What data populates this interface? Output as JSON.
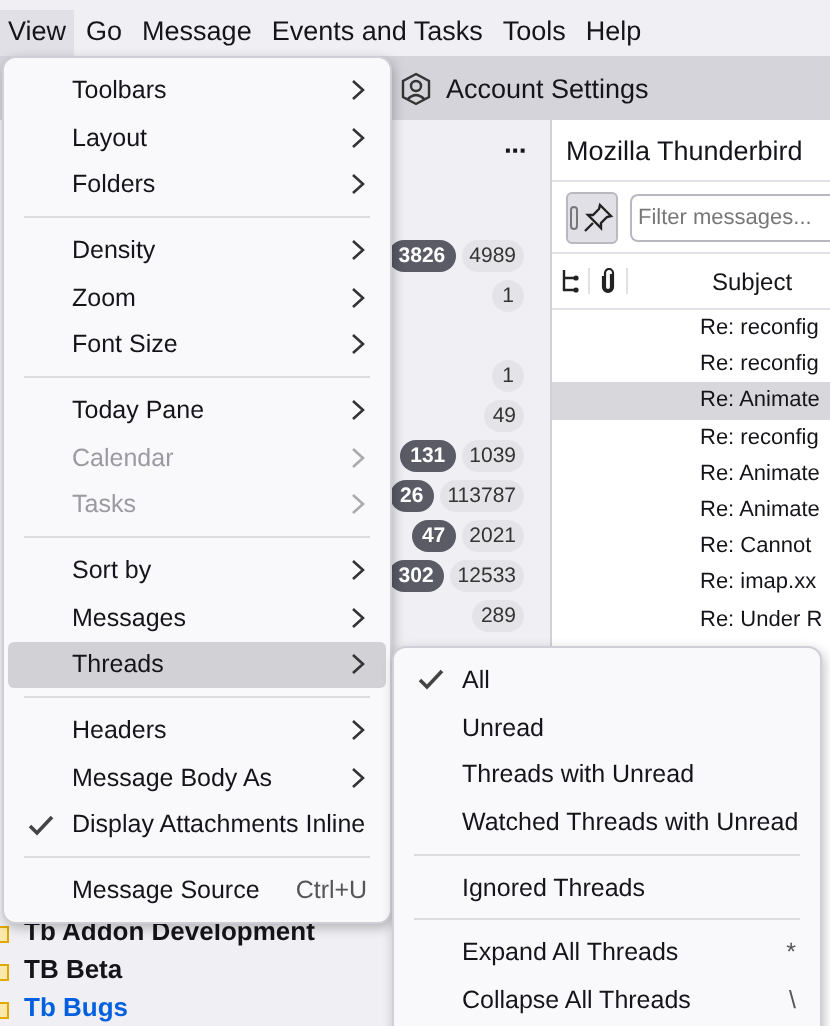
{
  "menubar": [
    {
      "label": "View",
      "selected": true
    },
    {
      "label": "Go",
      "selected": false
    },
    {
      "label": "Message",
      "selected": false
    },
    {
      "label": "Events and Tasks",
      "selected": false
    },
    {
      "label": "Tools",
      "selected": false
    },
    {
      "label": "Help",
      "selected": false
    }
  ],
  "tab": {
    "label": "Account Settings"
  },
  "folder_pane": {
    "menu_button": "···",
    "counts": [
      {
        "unread": "3826",
        "total": "4989"
      },
      {
        "total": "1"
      },
      {
        "total": "1"
      },
      {
        "total": "49"
      },
      {
        "unread": "131",
        "total": "1039"
      },
      {
        "unread": "26",
        "total": "113787"
      },
      {
        "unread": "47",
        "total": "2021"
      },
      {
        "unread": "302",
        "total": "12533"
      },
      {
        "total": "289"
      }
    ],
    "folders": [
      {
        "name": "Tb Addon Development",
        "bold": true,
        "link": false
      },
      {
        "name": "TB Beta",
        "bold": true,
        "link": false
      },
      {
        "name": "Tb Bugs",
        "bold": true,
        "link": true
      }
    ]
  },
  "message_pane": {
    "title": "Mozilla Thunderbird",
    "filter_placeholder": "Filter messages...",
    "subject_column": "Subject",
    "rows": [
      {
        "subject": "Re: reconfig",
        "selected": false
      },
      {
        "subject": "Re: reconfig",
        "selected": false
      },
      {
        "subject": "Re: Animate",
        "selected": true
      },
      {
        "subject": "Re: reconfig",
        "selected": false
      },
      {
        "subject": "Re: Animate",
        "selected": false
      },
      {
        "subject": "Re: Animate",
        "selected": false
      },
      {
        "subject": "Re: Cannot",
        "selected": false
      },
      {
        "subject": "Re: imap.xx",
        "selected": false
      },
      {
        "subject": "Re: Under R",
        "selected": false
      }
    ]
  },
  "view_menu": [
    {
      "kind": "item",
      "label": "Toolbars",
      "submenu": true,
      "disabled": false,
      "checked": false,
      "selected": false
    },
    {
      "kind": "item",
      "label": "Layout",
      "submenu": true,
      "disabled": false,
      "checked": false,
      "selected": false
    },
    {
      "kind": "item",
      "label": "Folders",
      "submenu": true,
      "disabled": false,
      "checked": false,
      "selected": false
    },
    {
      "kind": "separator"
    },
    {
      "kind": "item",
      "label": "Density",
      "submenu": true,
      "disabled": false,
      "checked": false,
      "selected": false
    },
    {
      "kind": "item",
      "label": "Zoom",
      "submenu": true,
      "disabled": false,
      "checked": false,
      "selected": false
    },
    {
      "kind": "item",
      "label": "Font Size",
      "submenu": true,
      "disabled": false,
      "checked": false,
      "selected": false
    },
    {
      "kind": "separator"
    },
    {
      "kind": "item",
      "label": "Today Pane",
      "submenu": true,
      "disabled": false,
      "checked": false,
      "selected": false
    },
    {
      "kind": "item",
      "label": "Calendar",
      "submenu": true,
      "disabled": true,
      "checked": false,
      "selected": false
    },
    {
      "kind": "item",
      "label": "Tasks",
      "submenu": true,
      "disabled": true,
      "checked": false,
      "selected": false
    },
    {
      "kind": "separator"
    },
    {
      "kind": "item",
      "label": "Sort by",
      "submenu": true,
      "disabled": false,
      "checked": false,
      "selected": false
    },
    {
      "kind": "item",
      "label": "Messages",
      "submenu": true,
      "disabled": false,
      "checked": false,
      "selected": false
    },
    {
      "kind": "item",
      "label": "Threads",
      "submenu": true,
      "disabled": false,
      "checked": false,
      "selected": true
    },
    {
      "kind": "separator"
    },
    {
      "kind": "item",
      "label": "Headers",
      "submenu": true,
      "disabled": false,
      "checked": false,
      "selected": false
    },
    {
      "kind": "item",
      "label": "Message Body As",
      "submenu": true,
      "disabled": false,
      "checked": false,
      "selected": false
    },
    {
      "kind": "item",
      "label": "Display Attachments Inline",
      "submenu": false,
      "disabled": false,
      "checked": true,
      "selected": false
    },
    {
      "kind": "separator"
    },
    {
      "kind": "item",
      "label": "Message Source",
      "shortcut": "Ctrl+U",
      "submenu": false,
      "disabled": false,
      "checked": false,
      "selected": false
    }
  ],
  "threads_menu": [
    {
      "kind": "item",
      "label": "All",
      "submenu": false,
      "disabled": false,
      "checked": true,
      "selected": false
    },
    {
      "kind": "item",
      "label": "Unread",
      "submenu": false,
      "disabled": false,
      "checked": false,
      "selected": false
    },
    {
      "kind": "item",
      "label": "Threads with Unread",
      "submenu": false,
      "disabled": false,
      "checked": false,
      "selected": false
    },
    {
      "kind": "item",
      "label": "Watched Threads with Unread",
      "submenu": false,
      "disabled": false,
      "checked": false,
      "selected": false
    },
    {
      "kind": "separator"
    },
    {
      "kind": "item",
      "label": "Ignored Threads",
      "submenu": false,
      "disabled": false,
      "checked": false,
      "selected": false
    },
    {
      "kind": "separator"
    },
    {
      "kind": "item",
      "label": "Expand All Threads",
      "shortcut": "*",
      "submenu": false,
      "disabled": false,
      "checked": false,
      "selected": false
    },
    {
      "kind": "item",
      "label": "Collapse All Threads",
      "shortcut": "\\",
      "submenu": false,
      "disabled": false,
      "checked": false,
      "selected": false
    }
  ]
}
